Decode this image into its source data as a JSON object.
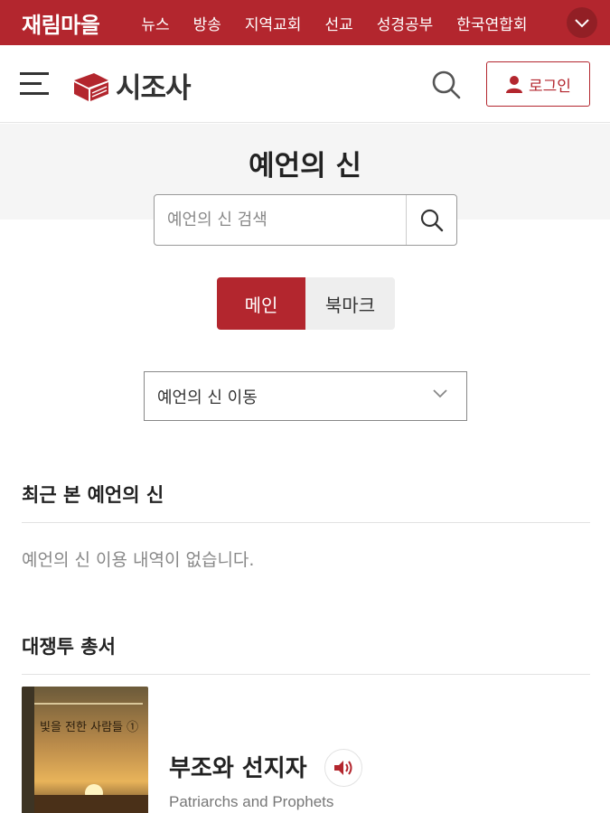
{
  "topbar": {
    "brand": "재림마을",
    "nav": [
      "뉴스",
      "방송",
      "지역교회",
      "선교",
      "성경공부",
      "한국연합회"
    ]
  },
  "header": {
    "logo_text": "시조사",
    "login_label": "로그인"
  },
  "page": {
    "title": "예언의 신",
    "search_placeholder": "예언의 신 검색"
  },
  "tabs": [
    {
      "label": "메인",
      "active": true
    },
    {
      "label": "북마크",
      "active": false
    }
  ],
  "dropdown": {
    "selected": "예언의 신 이동"
  },
  "recent": {
    "title": "최근 본 예언의 신",
    "empty_message": "예언의 신 이용 내역이 없습니다."
  },
  "series": {
    "title": "대쟁투 총서",
    "books": [
      {
        "title": "부조와 선지자",
        "subtitle": "Patriarchs and Prophets",
        "cover_text": "빛을 전한 사람들 ①"
      }
    ]
  },
  "colors": {
    "brand_red": "#b3262e"
  },
  "icons": {
    "menu": "hamburger-icon",
    "search": "search-icon",
    "user": "user-icon",
    "chevron": "chevron-down-icon",
    "audio": "speaker-icon"
  }
}
